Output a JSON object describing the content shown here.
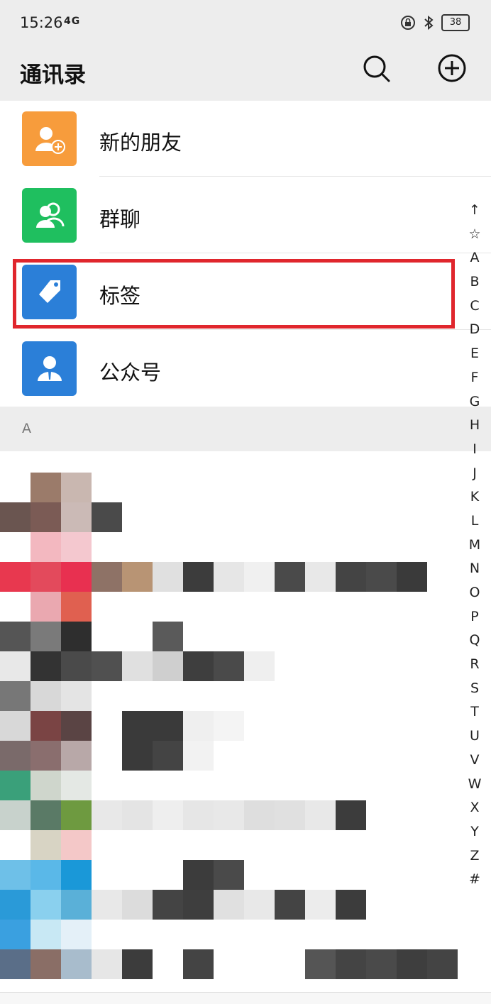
{
  "status": {
    "time": "15:26",
    "network": "4G",
    "battery": "38"
  },
  "header": {
    "title": "通讯录"
  },
  "functions": [
    {
      "label": "新的朋友",
      "icon": "add-friend-icon",
      "color": "#f79c3c"
    },
    {
      "label": "群聊",
      "icon": "group-chat-icon",
      "color": "#1fbf5f"
    },
    {
      "label": "标签",
      "icon": "tag-icon",
      "color": "#2b7fd8"
    },
    {
      "label": "公众号",
      "icon": "official-account-icon",
      "color": "#2b7fd8"
    }
  ],
  "section": {
    "letter": "A"
  },
  "index": [
    "↑",
    "☆",
    "A",
    "B",
    "C",
    "D",
    "E",
    "F",
    "G",
    "H",
    "I",
    "J",
    "K",
    "L",
    "M",
    "N",
    "O",
    "P",
    "Q",
    "R",
    "S",
    "T",
    "U",
    "V",
    "W",
    "X",
    "Y",
    "Z",
    "#"
  ],
  "colors": {
    "highlight": "#e0262d",
    "header_bg": "#ededed"
  }
}
